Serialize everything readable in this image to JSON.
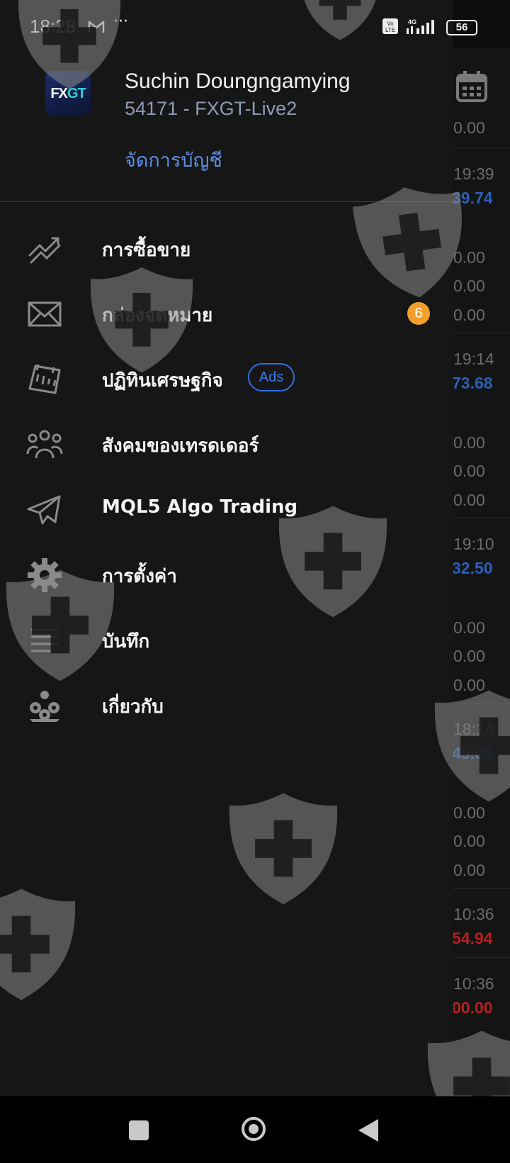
{
  "status_bar": {
    "time": "18:28",
    "dots": "···",
    "battery": "56"
  },
  "drawer": {
    "user_name": "Suchin Doungngamying",
    "account": "54171 - FXGT-Live2",
    "manage_label": "จัดการบัญชี",
    "logo_text_fx": "FX",
    "logo_text_gt": "GT",
    "items": [
      {
        "label": "การซื้อขาย",
        "icon": "trading-icon"
      },
      {
        "label": "กล่องจดหมาย",
        "icon": "mailbox-icon",
        "badge": "6"
      },
      {
        "label": "ปฏิทินเศรษฐกิจ",
        "icon": "calendar-icon",
        "tag": "Ads"
      },
      {
        "label": "สังคมของเทรดเดอร์",
        "icon": "community-icon"
      },
      {
        "label": "MQL5 Algo Trading",
        "icon": "telegram-icon"
      },
      {
        "label": "การตั้งค่า",
        "icon": "settings-icon"
      },
      {
        "label": "บันทึก",
        "icon": "journal-icon"
      },
      {
        "label": "เกี่ยวกับ",
        "icon": "about-icon"
      }
    ]
  },
  "background_list": [
    {
      "time": "0.00"
    },
    {
      "time": "19:39",
      "value": "39.74",
      "value_color": "#2c5fb8",
      "extras": [
        "0.00",
        "0.00",
        "0.00"
      ]
    },
    {
      "time": "19:14",
      "value": "73.68",
      "value_color": "#2c5fb8",
      "extras": [
        "0.00",
        "0.00",
        "0.00"
      ]
    },
    {
      "time": "19:10",
      "value": "32.50",
      "value_color": "#2c5fb8",
      "extras": [
        "0.00",
        "0.00",
        "0.00"
      ]
    },
    {
      "time": "18:14",
      "value": "45.00",
      "value_color": "#2c5fb8",
      "extras": [
        "0.00",
        "0.00",
        "0.00"
      ]
    },
    {
      "time": "10:36",
      "value": "54.94",
      "value_color": "#b52020"
    },
    {
      "time": "10:36",
      "value": "00.00",
      "value_color": "#b52020"
    }
  ]
}
